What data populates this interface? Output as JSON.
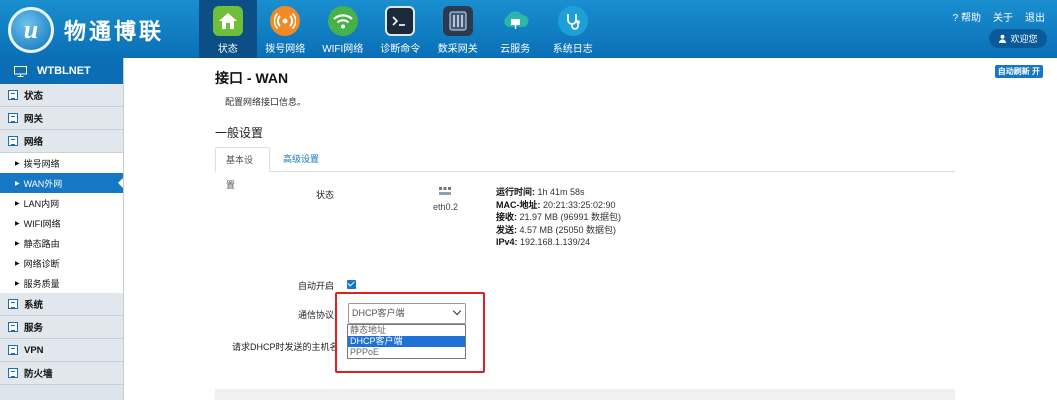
{
  "brand": {
    "logo_letter": "u",
    "name": "物通博联"
  },
  "nav": [
    {
      "label": "状态",
      "icon": "home-icon",
      "active": true
    },
    {
      "label": "拨号网络",
      "icon": "signal-icon"
    },
    {
      "label": "WIFI网络",
      "icon": "wifi-icon"
    },
    {
      "label": "诊断命令",
      "icon": "terminal-icon"
    },
    {
      "label": "数采网关",
      "icon": "gateway-icon"
    },
    {
      "label": "云服务",
      "icon": "cloud-icon"
    },
    {
      "label": "系统日志",
      "icon": "stethoscope-icon"
    }
  ],
  "topbar": {
    "help": "帮助",
    "about": "关于",
    "exit": "退出",
    "logout": "欢迎您"
  },
  "sidebar": {
    "title": "WTBLNET",
    "groups": [
      {
        "label": "状态"
      },
      {
        "label": "网关"
      },
      {
        "label": "网络"
      }
    ],
    "subitems": [
      {
        "label": "拨号网络"
      },
      {
        "label": "WAN外网",
        "active": true
      },
      {
        "label": "LAN内网"
      },
      {
        "label": "WIFI网络"
      },
      {
        "label": "静态路由"
      },
      {
        "label": "网络诊断"
      },
      {
        "label": "服务质量"
      }
    ],
    "groups_after": [
      {
        "label": "系统"
      },
      {
        "label": "服务"
      },
      {
        "label": "VPN"
      },
      {
        "label": "防火墙"
      }
    ]
  },
  "main": {
    "title": "接口 - WAN",
    "auto_refresh": "自动刷新 开",
    "description": "配置网络接口信息。",
    "section_title": "一般设置",
    "tabs": [
      "基本设置",
      "高级设置"
    ],
    "status_label": "状态",
    "interface": "eth0.2",
    "status_info": [
      {
        "key": "运行时间:",
        "value": " 1h 41m 58s"
      },
      {
        "key": "MAC-地址:",
        "value": " 20:21:33:25:02:90"
      },
      {
        "key": "接收:",
        "value": " 21.97 MB (96991 数据包)"
      },
      {
        "key": "发送:",
        "value": " 4.57 MB (25050 数据包)"
      },
      {
        "key": "IPv4:",
        "value": " 192.168.1.139/24"
      }
    ],
    "autostart_label": "自动开启",
    "protocol_label": "通信协议",
    "protocol_value": "DHCP客户端",
    "protocol_options": [
      "静态地址",
      "DHCP客户端",
      "PPPoE"
    ],
    "hostname_label": "请求DHCP时发送的主机名"
  },
  "colors": {
    "header": "#0a6fb6",
    "accent": "#1677c4",
    "highlight_box": "#e02020"
  }
}
